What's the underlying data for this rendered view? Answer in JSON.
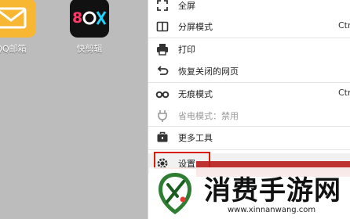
{
  "desktop": {
    "apps": [
      {
        "label": "QQ邮箱",
        "icon": "mail-icon",
        "color": "#f7b733"
      },
      {
        "label": "快剪辑",
        "icon": "video-editor-icon",
        "color": "#111111"
      }
    ]
  },
  "menu": {
    "items": [
      {
        "label": "全屏",
        "icon": "fullscreen-icon"
      },
      {
        "label": "分屏模式",
        "icon": "split-screen-icon",
        "shortcut": "Ctrl"
      },
      {
        "label": "打印",
        "icon": "printer-icon"
      },
      {
        "label": "恢复关闭的网页",
        "icon": "restore-icon"
      },
      {
        "label": "无痕模式",
        "icon": "incognito-icon",
        "shortcut": "Ctr"
      },
      {
        "label": "省电模式：禁用",
        "icon": "power-saving-icon"
      },
      {
        "label": "更多工具",
        "icon": "toolbox-icon"
      },
      {
        "label": "设置",
        "icon": "gear-icon"
      }
    ]
  },
  "watermark": {
    "title": "消费手游网",
    "url": "www.xinnanwang.com",
    "brand_color": "#2e7d32"
  }
}
